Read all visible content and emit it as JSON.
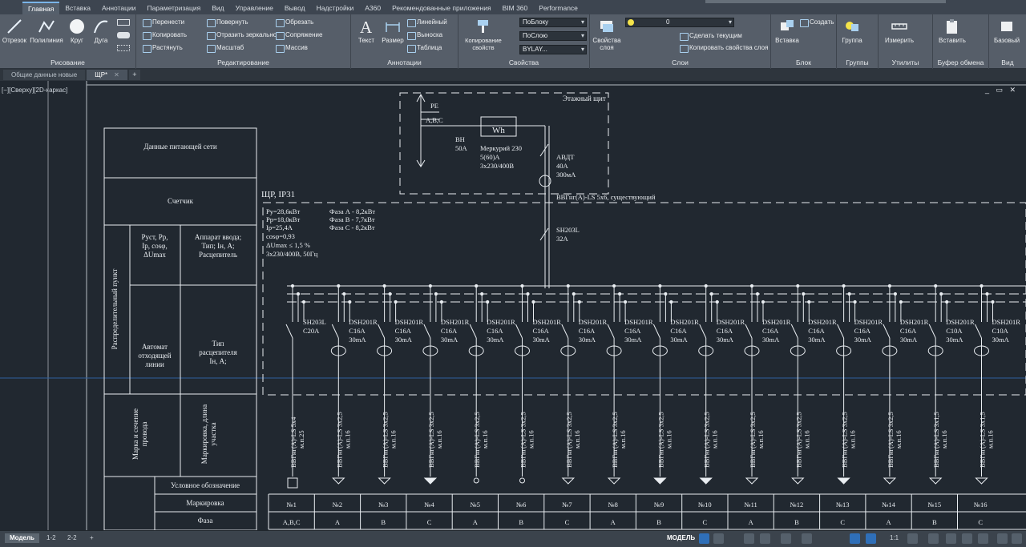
{
  "ribbon_tabs": [
    "Главная",
    "Вставка",
    "Аннотации",
    "Параметризация",
    "Вид",
    "Управление",
    "Вывод",
    "Надстройки",
    "A360",
    "Рекомендованные приложения",
    "BIM 360",
    "Performance"
  ],
  "active_tab": "Главная",
  "draw": {
    "title": "Рисование",
    "line": "Отрезок",
    "polyline": "Полилиния",
    "circle": "Круг",
    "arc": "Дуга"
  },
  "modify": {
    "title": "Редактирование",
    "move": "Перенести",
    "rotate": "Повернуть",
    "trim": "Обрезать",
    "copy": "Копировать",
    "mirror": "Отразить зеркально",
    "fillet": "Сопряжение",
    "stretch": "Растянуть",
    "scale": "Масштаб",
    "array": "Массив"
  },
  "annotation": {
    "title": "Аннотации",
    "text": "Текст",
    "dimension": "Размер",
    "linear": "Линейный",
    "leader": "Выноска",
    "table": "Таблица"
  },
  "properties": {
    "title": "Свойства",
    "match": "Копирование свойств",
    "by_block": "ПоБлоку",
    "by_layer_1": "ПоСлою",
    "by_layer_2": "BYLAY..."
  },
  "layers": {
    "title": "Слои",
    "layer_props": "Свойства слоя",
    "layer_value": "0",
    "make_current": "Сделать текущим",
    "match_layer": "Копировать свойства слоя"
  },
  "block": {
    "title": "Блок",
    "insert": "Вставка",
    "create": "Создать"
  },
  "groups": {
    "title": "Группы",
    "group": "Группа"
  },
  "utilities": {
    "title": "Утилиты",
    "measure": "Измерить"
  },
  "clipboard": {
    "title": "Буфер обмена",
    "paste": "Вставить"
  },
  "view": {
    "title": "Вид",
    "base": "Базовый"
  },
  "doc_tabs": [
    {
      "label": "Общие данные новые"
    },
    {
      "label": "ЩР*"
    }
  ],
  "viewport_label": "[−][Сверху][2D-каркас]",
  "drawing": {
    "header_rows": [
      "Данные питающей сети",
      "Счетчик"
    ],
    "side_label": "Распределительный пункт",
    "ust_label": [
      "Руст, Рр,",
      "Iр, cosφ,",
      "ΔUmax"
    ],
    "input_label": [
      "Аппарат ввода;",
      "Тип; Iн, А;",
      "Расцепитель"
    ],
    "breaker_label": [
      "Автомат",
      "отходящей",
      "линии"
    ],
    "release_label": [
      "Тип",
      "расцепителя",
      "Iн, А;"
    ],
    "cable_label": [
      "Марка и сечение",
      "провода"
    ],
    "mark_label": [
      "Маркировка, длина",
      "участка"
    ],
    "symbol_row": "Условное обозначение",
    "marking_row": "Маркировка",
    "phase_row": "Фаза",
    "panel_name": "ЩР, IP31",
    "panel_params": [
      "Ру=28,6кВт",
      "Рр=18,0кВт",
      "Iр=25,4А",
      "cosφ=0,93",
      "ΔUmax ≤ 1,5 %",
      "3x230/400В, 50Гц"
    ],
    "phase_loads": [
      "Фаза А - 8,2кВт",
      "Фаза В - 7,7кВт",
      "Фаза С - 8,2кВт"
    ],
    "floor_panel": "Этажный щит",
    "pe_label": "PE",
    "abc_label": "A,B,C",
    "vn_label": [
      "ВН",
      "50А"
    ],
    "meter_symbol": "Wh",
    "meter_label": [
      "Меркурий 230",
      "5(60)А",
      "3x230/400В"
    ],
    "avdt_label": [
      "АВДТ",
      "40А",
      "300мА"
    ],
    "feeder_cable": "ВВГнг(А)-LS 5x6, существующий",
    "main_breaker": [
      "SH203L",
      "32А"
    ],
    "circuits": [
      {
        "no": "№1",
        "phase": "А,В,С",
        "b1": "SH203L",
        "b2": "C20A",
        "b3": "",
        "cable": "ВВГнг(А)-LS 5x4",
        "mark": "м.п.25"
      },
      {
        "no": "№2",
        "phase": "А",
        "b1": "DSH201R",
        "b2": "C16A",
        "b3": "30mA",
        "cable": "ВВГнг(А)-LS 3x2,5",
        "mark": "м.п.16"
      },
      {
        "no": "№3",
        "phase": "В",
        "b1": "DSH201R",
        "b2": "C16A",
        "b3": "30mA",
        "cable": "ВВГнг(А)-LS 3x2,5",
        "mark": "м.п.16"
      },
      {
        "no": "№4",
        "phase": "С",
        "b1": "DSH201R",
        "b2": "C16A",
        "b3": "30mA",
        "cable": "ВВГнг(А)-LS 3x2,5",
        "mark": "м.п.16"
      },
      {
        "no": "№5",
        "phase": "А",
        "b1": "DSH201R",
        "b2": "C16A",
        "b3": "30mA",
        "cable": "ВВГнг(А)-LS 3x2,5",
        "mark": "м.п.16"
      },
      {
        "no": "№6",
        "phase": "В",
        "b1": "DSH201R",
        "b2": "C16A",
        "b3": "30mA",
        "cable": "ВВГнг(А)-LS 3x2,5",
        "mark": "м.п.16"
      },
      {
        "no": "№7",
        "phase": "С",
        "b1": "DSH201R",
        "b2": "C16A",
        "b3": "30mA",
        "cable": "ВВГнг(А)-LS 3x2,5",
        "mark": "м.п.16"
      },
      {
        "no": "№8",
        "phase": "А",
        "b1": "DSH201R",
        "b2": "C16A",
        "b3": "30mA",
        "cable": "ВВГнг(А)-LS 3x2,5",
        "mark": "м.п.16"
      },
      {
        "no": "№9",
        "phase": "В",
        "b1": "DSH201R",
        "b2": "C16A",
        "b3": "30mA",
        "cable": "ВВГнг(А)-LS 3x2,5",
        "mark": "м.п.16"
      },
      {
        "no": "№10",
        "phase": "С",
        "b1": "DSH201R",
        "b2": "C16A",
        "b3": "30mA",
        "cable": "ВВГнг(А)-LS 3x2,5",
        "mark": "м.п.16"
      },
      {
        "no": "№11",
        "phase": "А",
        "b1": "DSH201R",
        "b2": "C16A",
        "b3": "30mA",
        "cable": "ВВГнг(А)-LS 3x2,5",
        "mark": "м.п.16"
      },
      {
        "no": "№12",
        "phase": "В",
        "b1": "DSH201R",
        "b2": "C16A",
        "b3": "30mA",
        "cable": "ВВГнг(А)-LS 3x2,5",
        "mark": "м.п.16"
      },
      {
        "no": "№13",
        "phase": "С",
        "b1": "DSH201R",
        "b2": "C16A",
        "b3": "30mA",
        "cable": "ВВГнг(А)-LS 3x2,5",
        "mark": "м.п.16"
      },
      {
        "no": "№14",
        "phase": "А",
        "b1": "DSH201R",
        "b2": "C16A",
        "b3": "30mA",
        "cable": "ВВГнг(А)-LS 3x2,5",
        "mark": "м.п.16"
      },
      {
        "no": "№15",
        "phase": "В",
        "b1": "DSH201R",
        "b2": "C10A",
        "b3": "30mA",
        "cable": "ВВГнг(А)-LS 3x1,5",
        "mark": "м.п.16"
      },
      {
        "no": "№16",
        "phase": "С",
        "b1": "DSH201R",
        "b2": "C10A",
        "b3": "30mA",
        "cable": "ВВГнг(А)-LS 3x1,5",
        "mark": "м.п.16"
      }
    ]
  },
  "layout_tabs": [
    "Модель",
    "1-2",
    "2-2"
  ],
  "status": {
    "model": "МОДЕЛЬ",
    "scale": "1:1"
  }
}
